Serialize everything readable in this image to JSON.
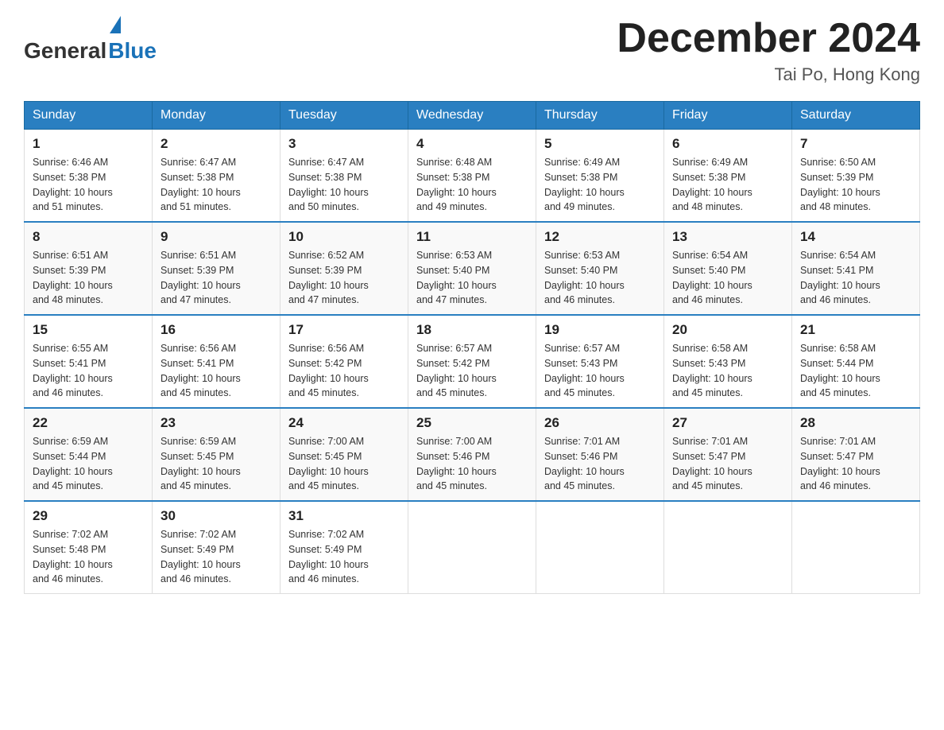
{
  "header": {
    "logo_general": "General",
    "logo_blue": "Blue",
    "month_title": "December 2024",
    "location": "Tai Po, Hong Kong"
  },
  "days_of_week": [
    "Sunday",
    "Monday",
    "Tuesday",
    "Wednesday",
    "Thursday",
    "Friday",
    "Saturday"
  ],
  "weeks": [
    [
      {
        "day": "1",
        "sunrise": "6:46 AM",
        "sunset": "5:38 PM",
        "daylight": "10 hours and 51 minutes."
      },
      {
        "day": "2",
        "sunrise": "6:47 AM",
        "sunset": "5:38 PM",
        "daylight": "10 hours and 51 minutes."
      },
      {
        "day": "3",
        "sunrise": "6:47 AM",
        "sunset": "5:38 PM",
        "daylight": "10 hours and 50 minutes."
      },
      {
        "day": "4",
        "sunrise": "6:48 AM",
        "sunset": "5:38 PM",
        "daylight": "10 hours and 49 minutes."
      },
      {
        "day": "5",
        "sunrise": "6:49 AM",
        "sunset": "5:38 PM",
        "daylight": "10 hours and 49 minutes."
      },
      {
        "day": "6",
        "sunrise": "6:49 AM",
        "sunset": "5:38 PM",
        "daylight": "10 hours and 48 minutes."
      },
      {
        "day": "7",
        "sunrise": "6:50 AM",
        "sunset": "5:39 PM",
        "daylight": "10 hours and 48 minutes."
      }
    ],
    [
      {
        "day": "8",
        "sunrise": "6:51 AM",
        "sunset": "5:39 PM",
        "daylight": "10 hours and 48 minutes."
      },
      {
        "day": "9",
        "sunrise": "6:51 AM",
        "sunset": "5:39 PM",
        "daylight": "10 hours and 47 minutes."
      },
      {
        "day": "10",
        "sunrise": "6:52 AM",
        "sunset": "5:39 PM",
        "daylight": "10 hours and 47 minutes."
      },
      {
        "day": "11",
        "sunrise": "6:53 AM",
        "sunset": "5:40 PM",
        "daylight": "10 hours and 47 minutes."
      },
      {
        "day": "12",
        "sunrise": "6:53 AM",
        "sunset": "5:40 PM",
        "daylight": "10 hours and 46 minutes."
      },
      {
        "day": "13",
        "sunrise": "6:54 AM",
        "sunset": "5:40 PM",
        "daylight": "10 hours and 46 minutes."
      },
      {
        "day": "14",
        "sunrise": "6:54 AM",
        "sunset": "5:41 PM",
        "daylight": "10 hours and 46 minutes."
      }
    ],
    [
      {
        "day": "15",
        "sunrise": "6:55 AM",
        "sunset": "5:41 PM",
        "daylight": "10 hours and 46 minutes."
      },
      {
        "day": "16",
        "sunrise": "6:56 AM",
        "sunset": "5:41 PM",
        "daylight": "10 hours and 45 minutes."
      },
      {
        "day": "17",
        "sunrise": "6:56 AM",
        "sunset": "5:42 PM",
        "daylight": "10 hours and 45 minutes."
      },
      {
        "day": "18",
        "sunrise": "6:57 AM",
        "sunset": "5:42 PM",
        "daylight": "10 hours and 45 minutes."
      },
      {
        "day": "19",
        "sunrise": "6:57 AM",
        "sunset": "5:43 PM",
        "daylight": "10 hours and 45 minutes."
      },
      {
        "day": "20",
        "sunrise": "6:58 AM",
        "sunset": "5:43 PM",
        "daylight": "10 hours and 45 minutes."
      },
      {
        "day": "21",
        "sunrise": "6:58 AM",
        "sunset": "5:44 PM",
        "daylight": "10 hours and 45 minutes."
      }
    ],
    [
      {
        "day": "22",
        "sunrise": "6:59 AM",
        "sunset": "5:44 PM",
        "daylight": "10 hours and 45 minutes."
      },
      {
        "day": "23",
        "sunrise": "6:59 AM",
        "sunset": "5:45 PM",
        "daylight": "10 hours and 45 minutes."
      },
      {
        "day": "24",
        "sunrise": "7:00 AM",
        "sunset": "5:45 PM",
        "daylight": "10 hours and 45 minutes."
      },
      {
        "day": "25",
        "sunrise": "7:00 AM",
        "sunset": "5:46 PM",
        "daylight": "10 hours and 45 minutes."
      },
      {
        "day": "26",
        "sunrise": "7:01 AM",
        "sunset": "5:46 PM",
        "daylight": "10 hours and 45 minutes."
      },
      {
        "day": "27",
        "sunrise": "7:01 AM",
        "sunset": "5:47 PM",
        "daylight": "10 hours and 45 minutes."
      },
      {
        "day": "28",
        "sunrise": "7:01 AM",
        "sunset": "5:47 PM",
        "daylight": "10 hours and 46 minutes."
      }
    ],
    [
      {
        "day": "29",
        "sunrise": "7:02 AM",
        "sunset": "5:48 PM",
        "daylight": "10 hours and 46 minutes."
      },
      {
        "day": "30",
        "sunrise": "7:02 AM",
        "sunset": "5:49 PM",
        "daylight": "10 hours and 46 minutes."
      },
      {
        "day": "31",
        "sunrise": "7:02 AM",
        "sunset": "5:49 PM",
        "daylight": "10 hours and 46 minutes."
      },
      null,
      null,
      null,
      null
    ]
  ],
  "labels": {
    "sunrise": "Sunrise:",
    "sunset": "Sunset:",
    "daylight": "Daylight:"
  }
}
